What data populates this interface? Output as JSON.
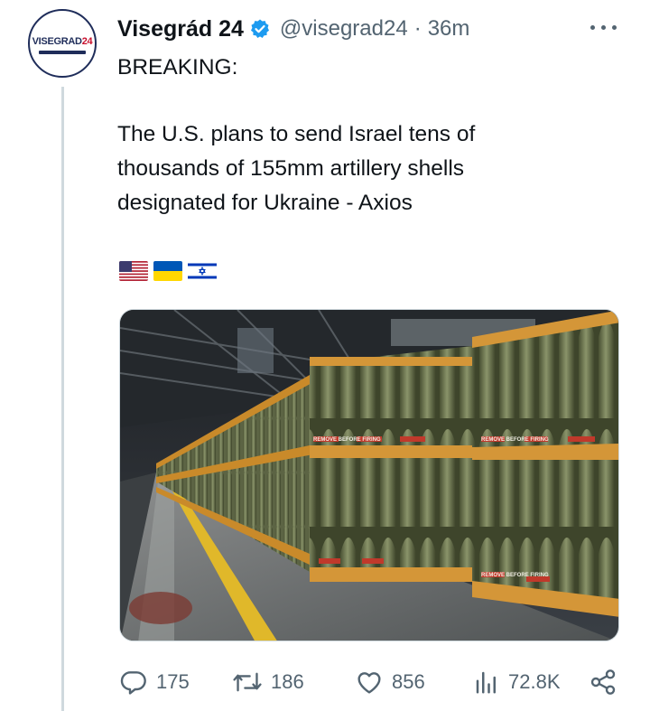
{
  "tweet": {
    "author_name": "Visegrád 24",
    "handle": "@visegrad24",
    "separator": "·",
    "time": "36m",
    "avatar_logo": "VISEGRAD24",
    "lines": [
      "BREAKING:",
      "The U.S. plans to send Israel tens of",
      "thousands of 155mm artillery shells",
      "designated for Ukraine - Axios"
    ],
    "flags": [
      "us-flag",
      "ukraine-flag",
      "israel-flag"
    ],
    "image": {
      "subject": "warehouse-artillery-shells-photo",
      "pallet_labels": [
        "REMOVE BEFORE FIRING",
        "REMOVE BEFORE FIRING",
        "REMOVE BEFORE FIRING"
      ]
    }
  },
  "actions": {
    "replies": "175",
    "retweets": "186",
    "likes": "856",
    "views": "72.8K"
  },
  "colors": {
    "text": "#0f1419",
    "secondary": "#536471",
    "verified": "#1d9bf0",
    "thread_line": "#cfd9de"
  }
}
